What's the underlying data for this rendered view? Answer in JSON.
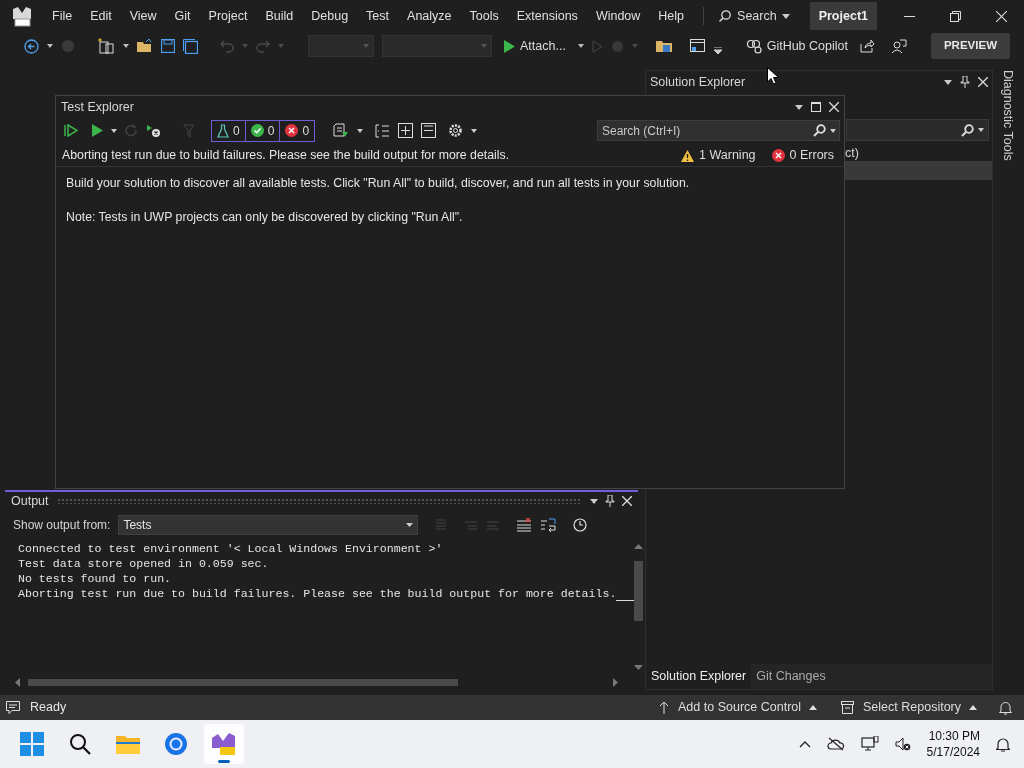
{
  "menu_bar": {
    "items": [
      "File",
      "Edit",
      "View",
      "Git",
      "Project",
      "Build",
      "Debug",
      "Test",
      "Analyze",
      "Tools",
      "Extensions",
      "Window",
      "Help"
    ],
    "search": "Search",
    "solution_name": "Project1"
  },
  "toolbar": {
    "attach": "Attach...",
    "copilot": "GitHub Copilot",
    "preview": "PREVIEW"
  },
  "solution_explorer": {
    "title": "Solution Explorer",
    "partial_text": "ct)"
  },
  "diagnostic_tab": "Diagnostic Tools",
  "test_explorer": {
    "title": "Test Explorer",
    "counts": [
      {
        "kind": "total",
        "count": "0"
      },
      {
        "kind": "passed",
        "count": "0"
      },
      {
        "kind": "failed",
        "count": "0"
      }
    ],
    "search_placeholder": "Search (Ctrl+I)",
    "message": "Aborting test run due to build failures. Please see the build output for more details.",
    "warnings": "1 Warning",
    "errors": "0 Errors",
    "body_lines": [
      "Build your solution to discover all available tests. Click \"Run All\" to build, discover, and run all tests in your solution.",
      "Note: Tests in UWP projects can only be discovered by clicking \"Run All\"."
    ]
  },
  "output": {
    "title": "Output",
    "source_label": "Show output from:",
    "source": "Tests",
    "lines": [
      "Connected to test environment '< Local Windows Environment >'",
      "Test data store opened in 0.059 sec.",
      "No tests found to run.",
      "Aborting test run due to build failures. Please see the build output for more details."
    ]
  },
  "bottom_tabs": [
    {
      "label": "Solution Explorer",
      "selected": true
    },
    {
      "label": "Git Changes",
      "selected": false
    }
  ],
  "status_bar": {
    "text": "Ready",
    "source_control": "Add to Source Control",
    "repository": "Select Repository"
  },
  "taskbar": {
    "apps": [
      {
        "kind": "start",
        "selected": false
      },
      {
        "kind": "search",
        "selected": false
      },
      {
        "kind": "files",
        "selected": false
      },
      {
        "kind": "browser",
        "selected": false
      },
      {
        "kind": "studio",
        "selected": true
      }
    ],
    "time": "10:30 PM",
    "date": "5/17/2024"
  }
}
